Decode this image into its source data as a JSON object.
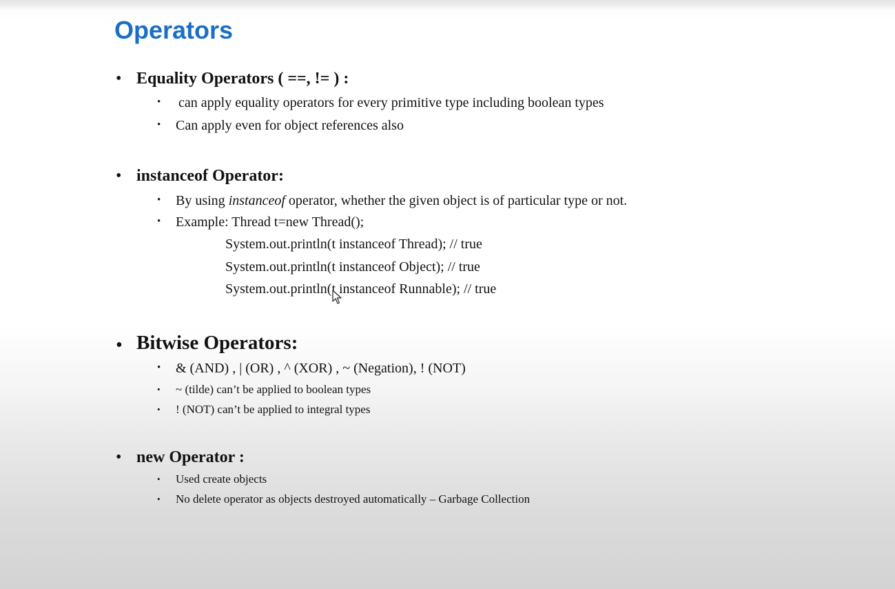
{
  "title": "Operators",
  "sections": [
    {
      "heading": "Equality Operators ( ==,  != ) :",
      "items": [
        "can apply equality operators for every primitive type including boolean types",
        "Can apply even for object references also"
      ]
    },
    {
      "heading": "instanceof Operator:",
      "items": [
        {
          "prefix": "By using ",
          "emphasis": "instanceof",
          "suffix": " operator, whether the given object  is of particular type or not."
        },
        "Example:  Thread t=new Thread();"
      ],
      "code_lines": [
        "System.out.println(t instanceof  Thread); // true",
        "System.out.println(t instanceof  Object); // true",
        "System.out.println(t instanceof  Runnable); // true"
      ]
    },
    {
      "heading": "Bitwise Operators:",
      "items": [
        "& (AND) , | (OR) , ^ (XOR) , ~ (Negation), ! (NOT)",
        "~ (tilde) can’t be applied to boolean types",
        "! (NOT) can’t be applied to integral types"
      ]
    },
    {
      "heading": "new Operator :",
      "items": [
        "Used create objects",
        "No delete operator as objects destroyed automatically – Garbage Collection"
      ]
    }
  ],
  "bullet_glyph": "•",
  "colors": {
    "title": "#1a6fc4",
    "text": "#111111"
  },
  "icons": {
    "cursor": "mouse-pointer-icon"
  }
}
